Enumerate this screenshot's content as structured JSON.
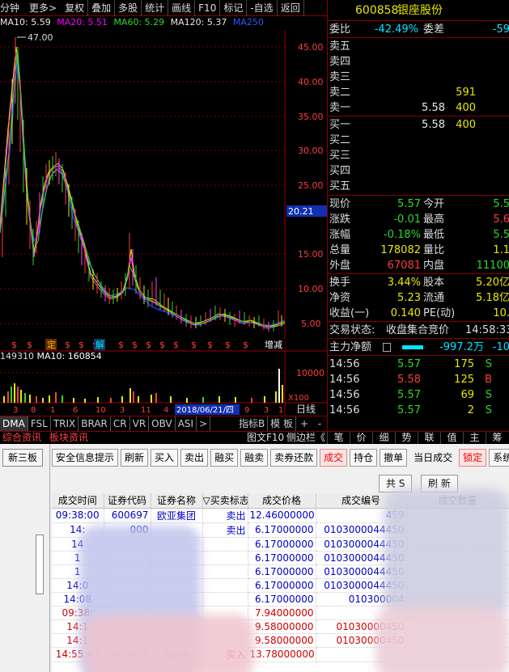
{
  "toolbar": {
    "period": "分钟",
    "more": "更多>",
    "buttons": [
      "复权",
      "叠加",
      "多股",
      "统计",
      "画线",
      "F10",
      "标记",
      "-自选",
      "返回"
    ]
  },
  "ma_line": {
    "ma10": "MA10: 5.59",
    "ma20": "MA20: 5.51",
    "ma60": "MA60: 5.29",
    "ma120": "MA120: 5.37",
    "ma250": "MA250"
  },
  "price_chart": {
    "high_label": "47.00",
    "current_tag": "20.21",
    "date_tag": "2018/06/21/四",
    "event_marks": [
      "$",
      "$",
      "定",
      "$",
      "$",
      "$",
      "解",
      "$",
      "$",
      "$",
      "$",
      "$",
      "$",
      "$",
      "$",
      "$"
    ],
    "event_end_mark": "增减",
    "y_ticks": [
      "45.00",
      "40.00",
      "35.00",
      "30.00",
      "25.00",
      "15.00",
      "10.00",
      "5.00"
    ],
    "vol_ticks": [
      "10000",
      "X100"
    ],
    "x_ticks": [
      "3",
      "8",
      "1",
      "6",
      "10",
      "3",
      "11",
      "4",
      "9",
      "3",
      "1"
    ],
    "y_axis_label": "日线",
    "axis_buttons": [
      "+",
      "-"
    ]
  },
  "volume_line": {
    "vol": "149310",
    "ma10": "MA10: 160854"
  },
  "indicator_tabs": [
    "DMA",
    "FSL",
    "TRIX",
    "BRAR",
    "CR",
    "VR",
    "OBV",
    "ASI",
    ">",
    "指标B",
    "模 板"
  ],
  "quote": {
    "code": "600858",
    "name": "银座股份",
    "weibi_label": "委比",
    "weibi_value": "-42.49%",
    "weicha_label": "委差",
    "weicha_value": "-59",
    "asks": [
      {
        "label": "卖五",
        "price": "",
        "vol": ""
      },
      {
        "label": "卖四",
        "price": "",
        "vol": ""
      },
      {
        "label": "卖三",
        "price": "",
        "vol": ""
      },
      {
        "label": "卖二",
        "price": "",
        "vol": "591"
      },
      {
        "label": "卖一",
        "price": "5.58",
        "vol": "400"
      }
    ],
    "bids": [
      {
        "label": "买一",
        "price": "5.58",
        "vol": "400"
      },
      {
        "label": "买二",
        "price": "",
        "vol": ""
      },
      {
        "label": "买三",
        "price": "",
        "vol": ""
      },
      {
        "label": "买四",
        "price": "",
        "vol": ""
      },
      {
        "label": "买五",
        "price": "",
        "vol": ""
      }
    ],
    "stats": [
      {
        "l1": "现价",
        "v1": "5.57",
        "l2": "今开",
        "v2": "5.5"
      },
      {
        "l1": "涨跌",
        "v1": "-0.01",
        "l2": "最高",
        "v2": "5.6"
      },
      {
        "l1": "涨幅",
        "v1": "-0.18%",
        "l2": "最低",
        "v2": "5.5"
      },
      {
        "l1": "总量",
        "v1": "178082",
        "l2": "量比",
        "v2": "1.1"
      },
      {
        "l1": "外盘",
        "v1": "67081",
        "l2": "内盘",
        "v2": "11100"
      }
    ],
    "finance": [
      {
        "l1": "换手",
        "v1": "3.44%",
        "l2": "股本",
        "v2": "5.20亿"
      },
      {
        "l1": "净资",
        "v1": "5.23",
        "l2": "流通",
        "v2": "5.18亿"
      },
      {
        "l1": "收益(一)",
        "v1": "0.140",
        "l2": "PE(动)",
        "v2": "10."
      }
    ],
    "status_label": "交易状态:",
    "status_value": "收盘集合竞价",
    "status_time": "14:58:33",
    "capital_label": "主力净额",
    "capital_value": "-997.2万",
    "capital_pct": "-10",
    "ticks": [
      {
        "time": "14:56",
        "price": "5.57",
        "vol": "175",
        "flag": "S"
      },
      {
        "time": "14:56",
        "price": "5.58",
        "vol": "125",
        "flag": "B"
      },
      {
        "time": "14:56",
        "price": "5.57",
        "vol": "69",
        "flag": "S"
      },
      {
        "time": "14:56",
        "price": "5.57",
        "vol": "2",
        "flag": "S"
      }
    ]
  },
  "mid_bar": {
    "left_tabs": [
      "综合资讯",
      "板块资讯"
    ],
    "center_text": "图文F10",
    "sidebar_text": "侧边栏《",
    "right_tabs": [
      "笔",
      "价",
      "细",
      "势",
      "联",
      "值",
      "主",
      "筹"
    ]
  },
  "trade": {
    "left_button": "新三板",
    "toolbar": [
      "安全信息提示",
      "刷新",
      "买入",
      "卖出",
      "融买",
      "融卖",
      "卖券还款",
      "成交",
      "持仓",
      "撤单",
      "当日成交",
      "锁定",
      "系统"
    ],
    "sub_buttons": [
      "共 S",
      "刷 新"
    ],
    "columns": [
      "成交时间",
      "证券代码",
      "证券名称",
      "▽买卖标志",
      "成交价格",
      "成交编号",
      "成交数量"
    ],
    "rows": [
      {
        "time": "09:38:00",
        "code": "600697",
        "name": "欧亚集团",
        "side": "卖出",
        "price": "12.46000000",
        "no": "459",
        "type": "sell"
      },
      {
        "time": "14:",
        "code": "000",
        "name": "",
        "side": "卖出",
        "price": "6.17000000",
        "no": "0103000044450",
        "type": "sell"
      },
      {
        "time": "14",
        "code": "",
        "name": "",
        "side": "",
        "price": "6.17000000",
        "no": "0103000044450",
        "type": "sell"
      },
      {
        "time": "1",
        "code": "",
        "name": "",
        "side": "",
        "price": "6.17000000",
        "no": "0103000044450",
        "type": "sell"
      },
      {
        "time": "1",
        "code": "",
        "name": "",
        "side": "",
        "price": "6.17000000",
        "no": "0103000044450",
        "type": "sell"
      },
      {
        "time": "14:0",
        "code": "",
        "name": "",
        "side": "",
        "price": "6.17000000",
        "no": "0103000044450",
        "type": "sell"
      },
      {
        "time": "14:08",
        "code": "",
        "name": "",
        "side": "",
        "price": "6.17000000",
        "no": "010300004",
        "type": "sell"
      },
      {
        "time": "09:38:",
        "code": "",
        "name": "",
        "side": "",
        "price": "7.94000000",
        "no": "",
        "type": "buy"
      },
      {
        "time": "14:1",
        "code": "",
        "name": "",
        "side": "",
        "price": "9.58000000",
        "no": "01030000450",
        "type": "buy"
      },
      {
        "time": "14:1",
        "code": "",
        "name": "",
        "side": "",
        "price": "9.58000000",
        "no": "01030000450",
        "type": "buy"
      },
      {
        "time": "14:55:47",
        "code": "600859",
        "name": "王府井",
        "side": "买入",
        "price": "13.78000000",
        "no": "",
        "type": "buy"
      }
    ]
  },
  "colors": {
    "up": "#ff3d3d",
    "down": "#2bd82b",
    "highlight": "#e8e800",
    "accent": "#00e5ff",
    "ma10": "#ffffff",
    "ma20": "#ffff00",
    "ma60": "#ff00ff",
    "ma250": "#3355ff"
  }
}
